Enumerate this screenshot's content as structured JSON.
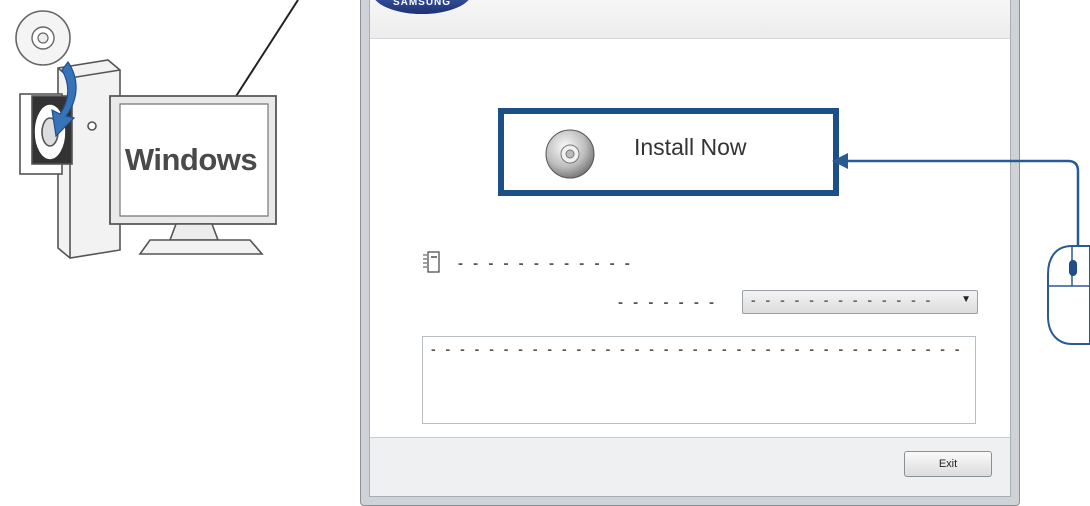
{
  "illustration": {
    "monitor_label": "Windows"
  },
  "installer": {
    "logo_text": "SAMSUNG",
    "install_button_label": "Install Now",
    "option_label": "- - - - - - - - - - - -",
    "select_label": "- - - - - - -",
    "select_value": "- - - - - - - - - - - - -",
    "description": "- - - - - - - - - - - - - - - - - - - - - - - - - - - - - - - - - - - - -",
    "exit_label": "Exit"
  },
  "colors": {
    "highlight_frame": "#1b4f86",
    "arrow": "#2a5a94"
  }
}
